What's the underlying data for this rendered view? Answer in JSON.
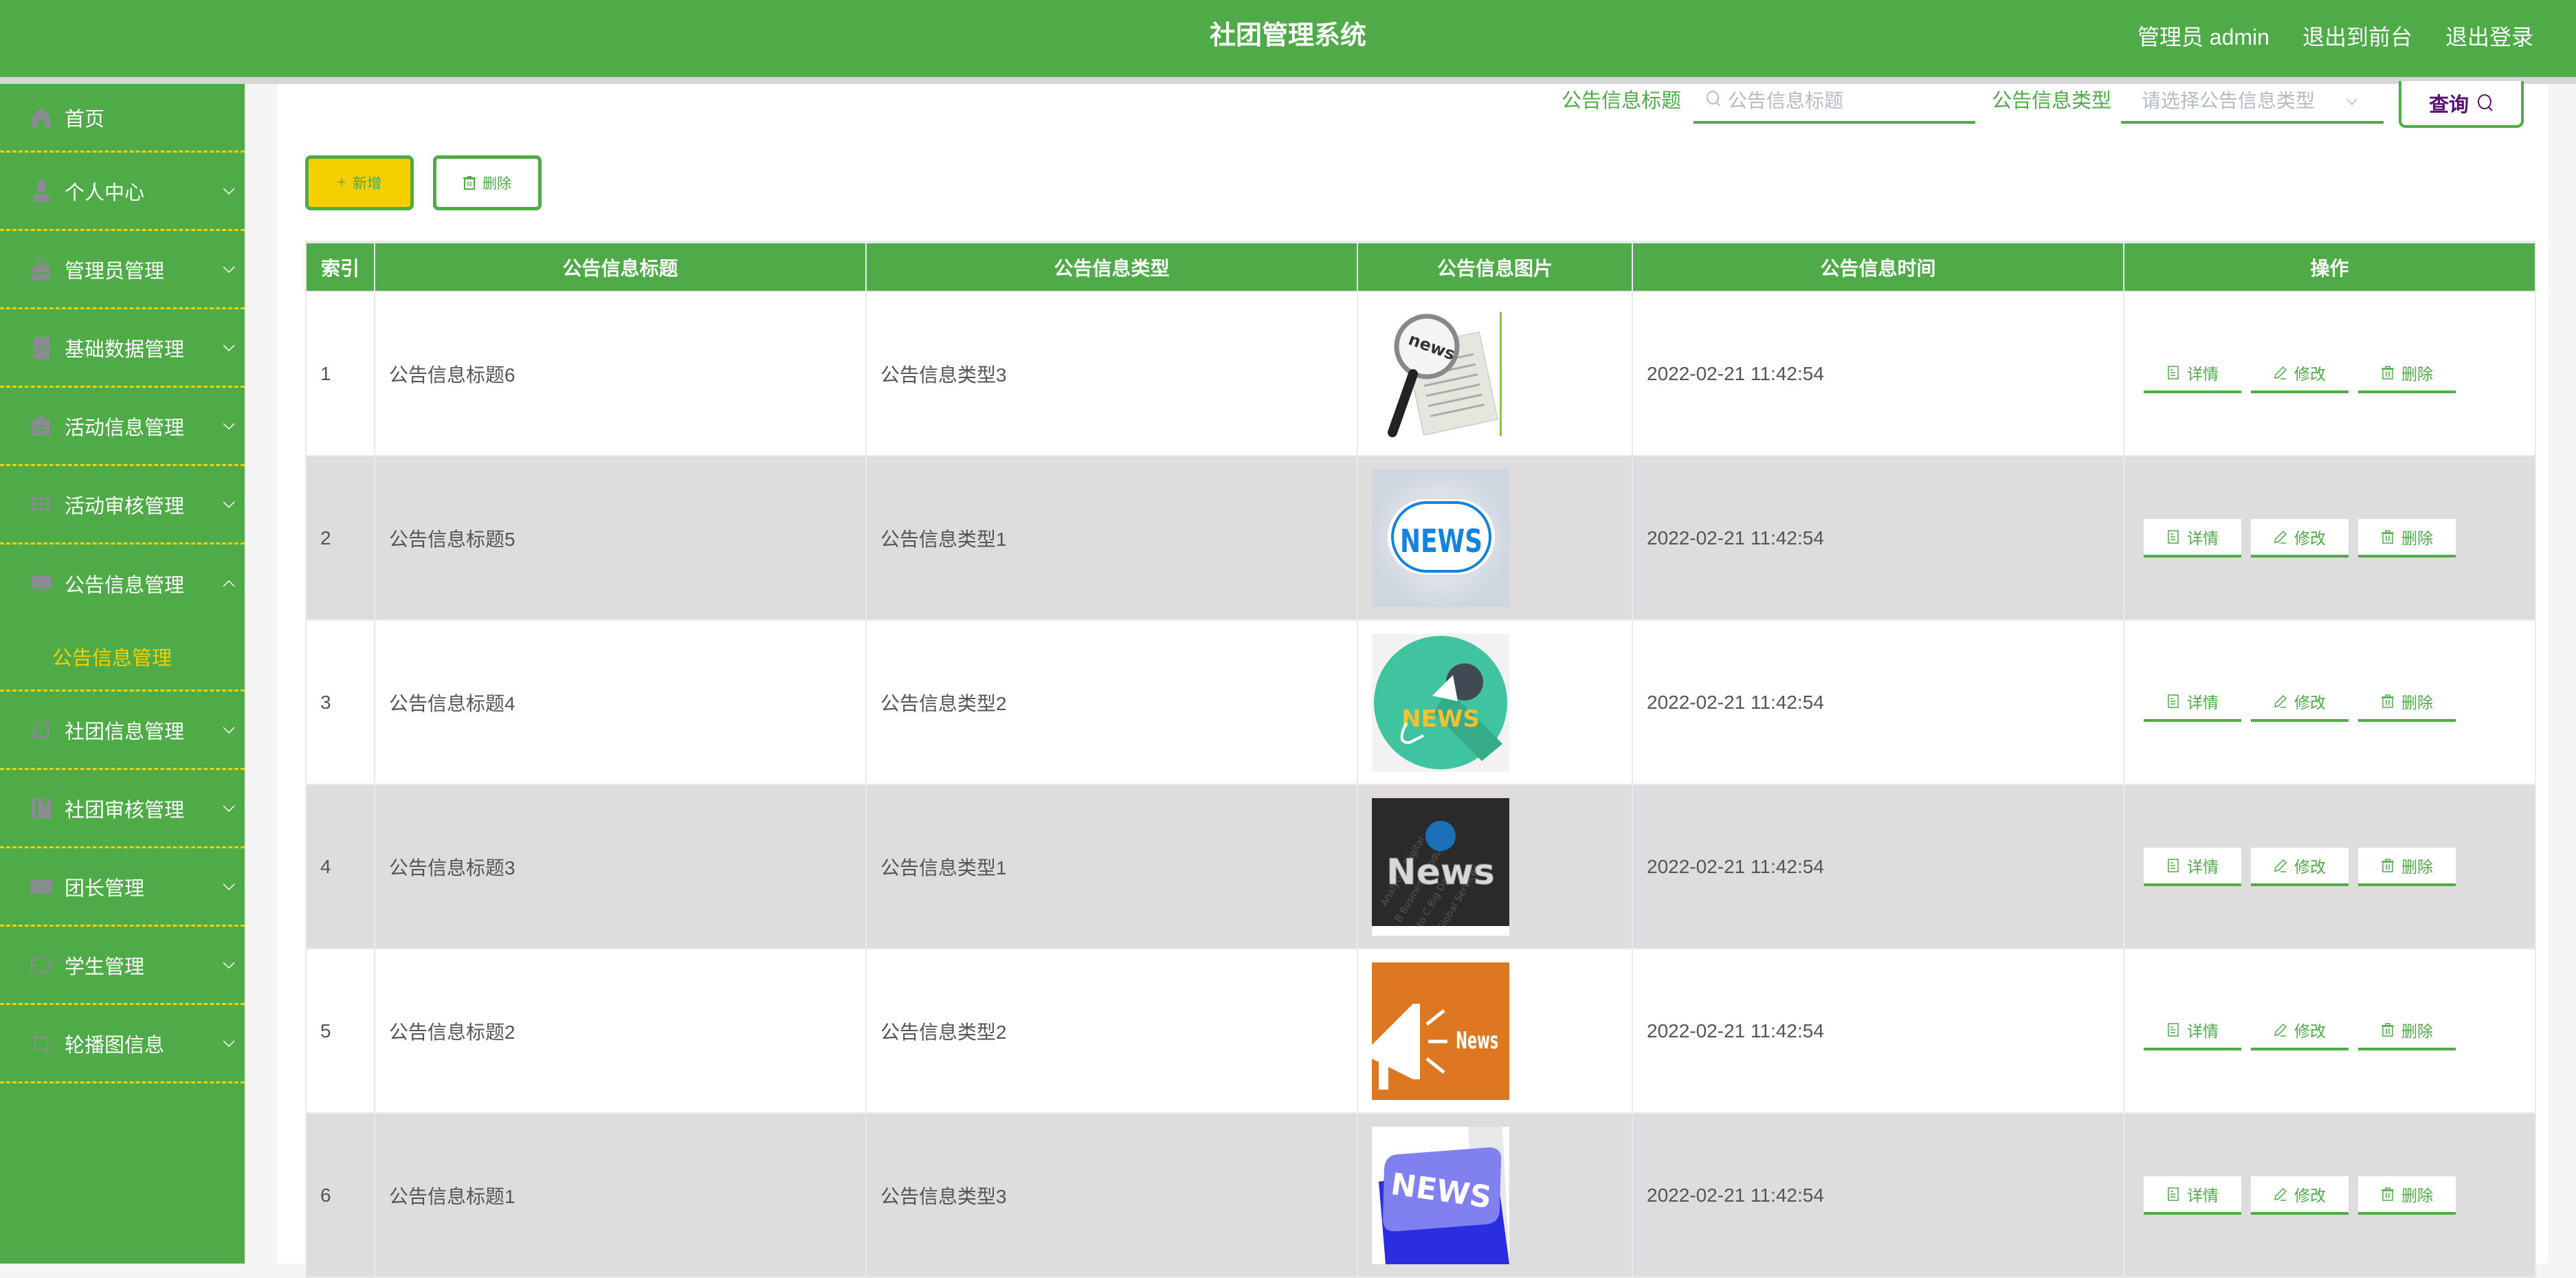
{
  "header": {
    "title": "社团管理系统",
    "user": "管理员 admin",
    "to_frontend": "退出到前台",
    "logout": "退出登录"
  },
  "sidebar": {
    "items": [
      {
        "label": "首页",
        "icon": "home-icon"
      },
      {
        "label": "个人中心",
        "icon": "user-icon"
      },
      {
        "label": "管理员管理",
        "icon": "lock-icon"
      },
      {
        "label": "基础数据管理",
        "icon": "chart-icon"
      },
      {
        "label": "活动信息管理",
        "icon": "clipboard-icon"
      },
      {
        "label": "活动审核管理",
        "icon": "grid-icon"
      },
      {
        "label": "公告信息管理",
        "icon": "monitor-icon",
        "expanded": true,
        "children": [
          {
            "label": "公告信息管理",
            "active": true
          }
        ]
      },
      {
        "label": "社团信息管理",
        "icon": "bell-off-icon"
      },
      {
        "label": "社团审核管理",
        "icon": "bookmark-icon"
      },
      {
        "label": "团长管理",
        "icon": "ticket-icon"
      },
      {
        "label": "学生管理",
        "icon": "crosshair-icon"
      },
      {
        "label": "轮播图信息",
        "icon": "crop-icon"
      }
    ]
  },
  "search": {
    "title_label": "公告信息标题",
    "title_placeholder": "公告信息标题",
    "type_label": "公告信息类型",
    "type_placeholder": "请选择公告信息类型",
    "query_button": "查询"
  },
  "toolbar": {
    "add_label": "新增",
    "delete_label": "删除"
  },
  "table": {
    "columns": [
      "索引",
      "公告信息标题",
      "公告信息类型",
      "公告信息图片",
      "公告信息时间",
      "操作"
    ],
    "rows": [
      {
        "index": "1",
        "title": "公告信息标题6",
        "type": "公告信息类型3",
        "image": "news-magnifier",
        "time": "2022-02-21 11:42:54"
      },
      {
        "index": "2",
        "title": "公告信息标题5",
        "type": "公告信息类型1",
        "image": "news-badge-blue",
        "time": "2022-02-21 11:42:54"
      },
      {
        "index": "3",
        "title": "公告信息标题4",
        "type": "公告信息类型2",
        "image": "news-microphone-green",
        "time": "2022-02-21 11:42:54"
      },
      {
        "index": "4",
        "title": "公告信息标题3",
        "type": "公告信息类型1",
        "image": "news-globe-dark",
        "time": "2022-02-21 11:42:54"
      },
      {
        "index": "5",
        "title": "公告信息标题2",
        "type": "公告信息类型2",
        "image": "news-megaphone-orange",
        "time": "2022-02-21 11:42:54"
      },
      {
        "index": "6",
        "title": "公告信息标题1",
        "type": "公告信息类型3",
        "image": "news-key-blue",
        "time": "2022-02-21 11:42:54"
      }
    ],
    "actions": {
      "detail": "详情",
      "edit": "修改",
      "delete": "删除"
    }
  },
  "colors": {
    "primary": "#4faa48",
    "accent_yellow": "#f5cf00",
    "query_text": "#5b0e7a",
    "row_alt": "#dedcdd"
  }
}
